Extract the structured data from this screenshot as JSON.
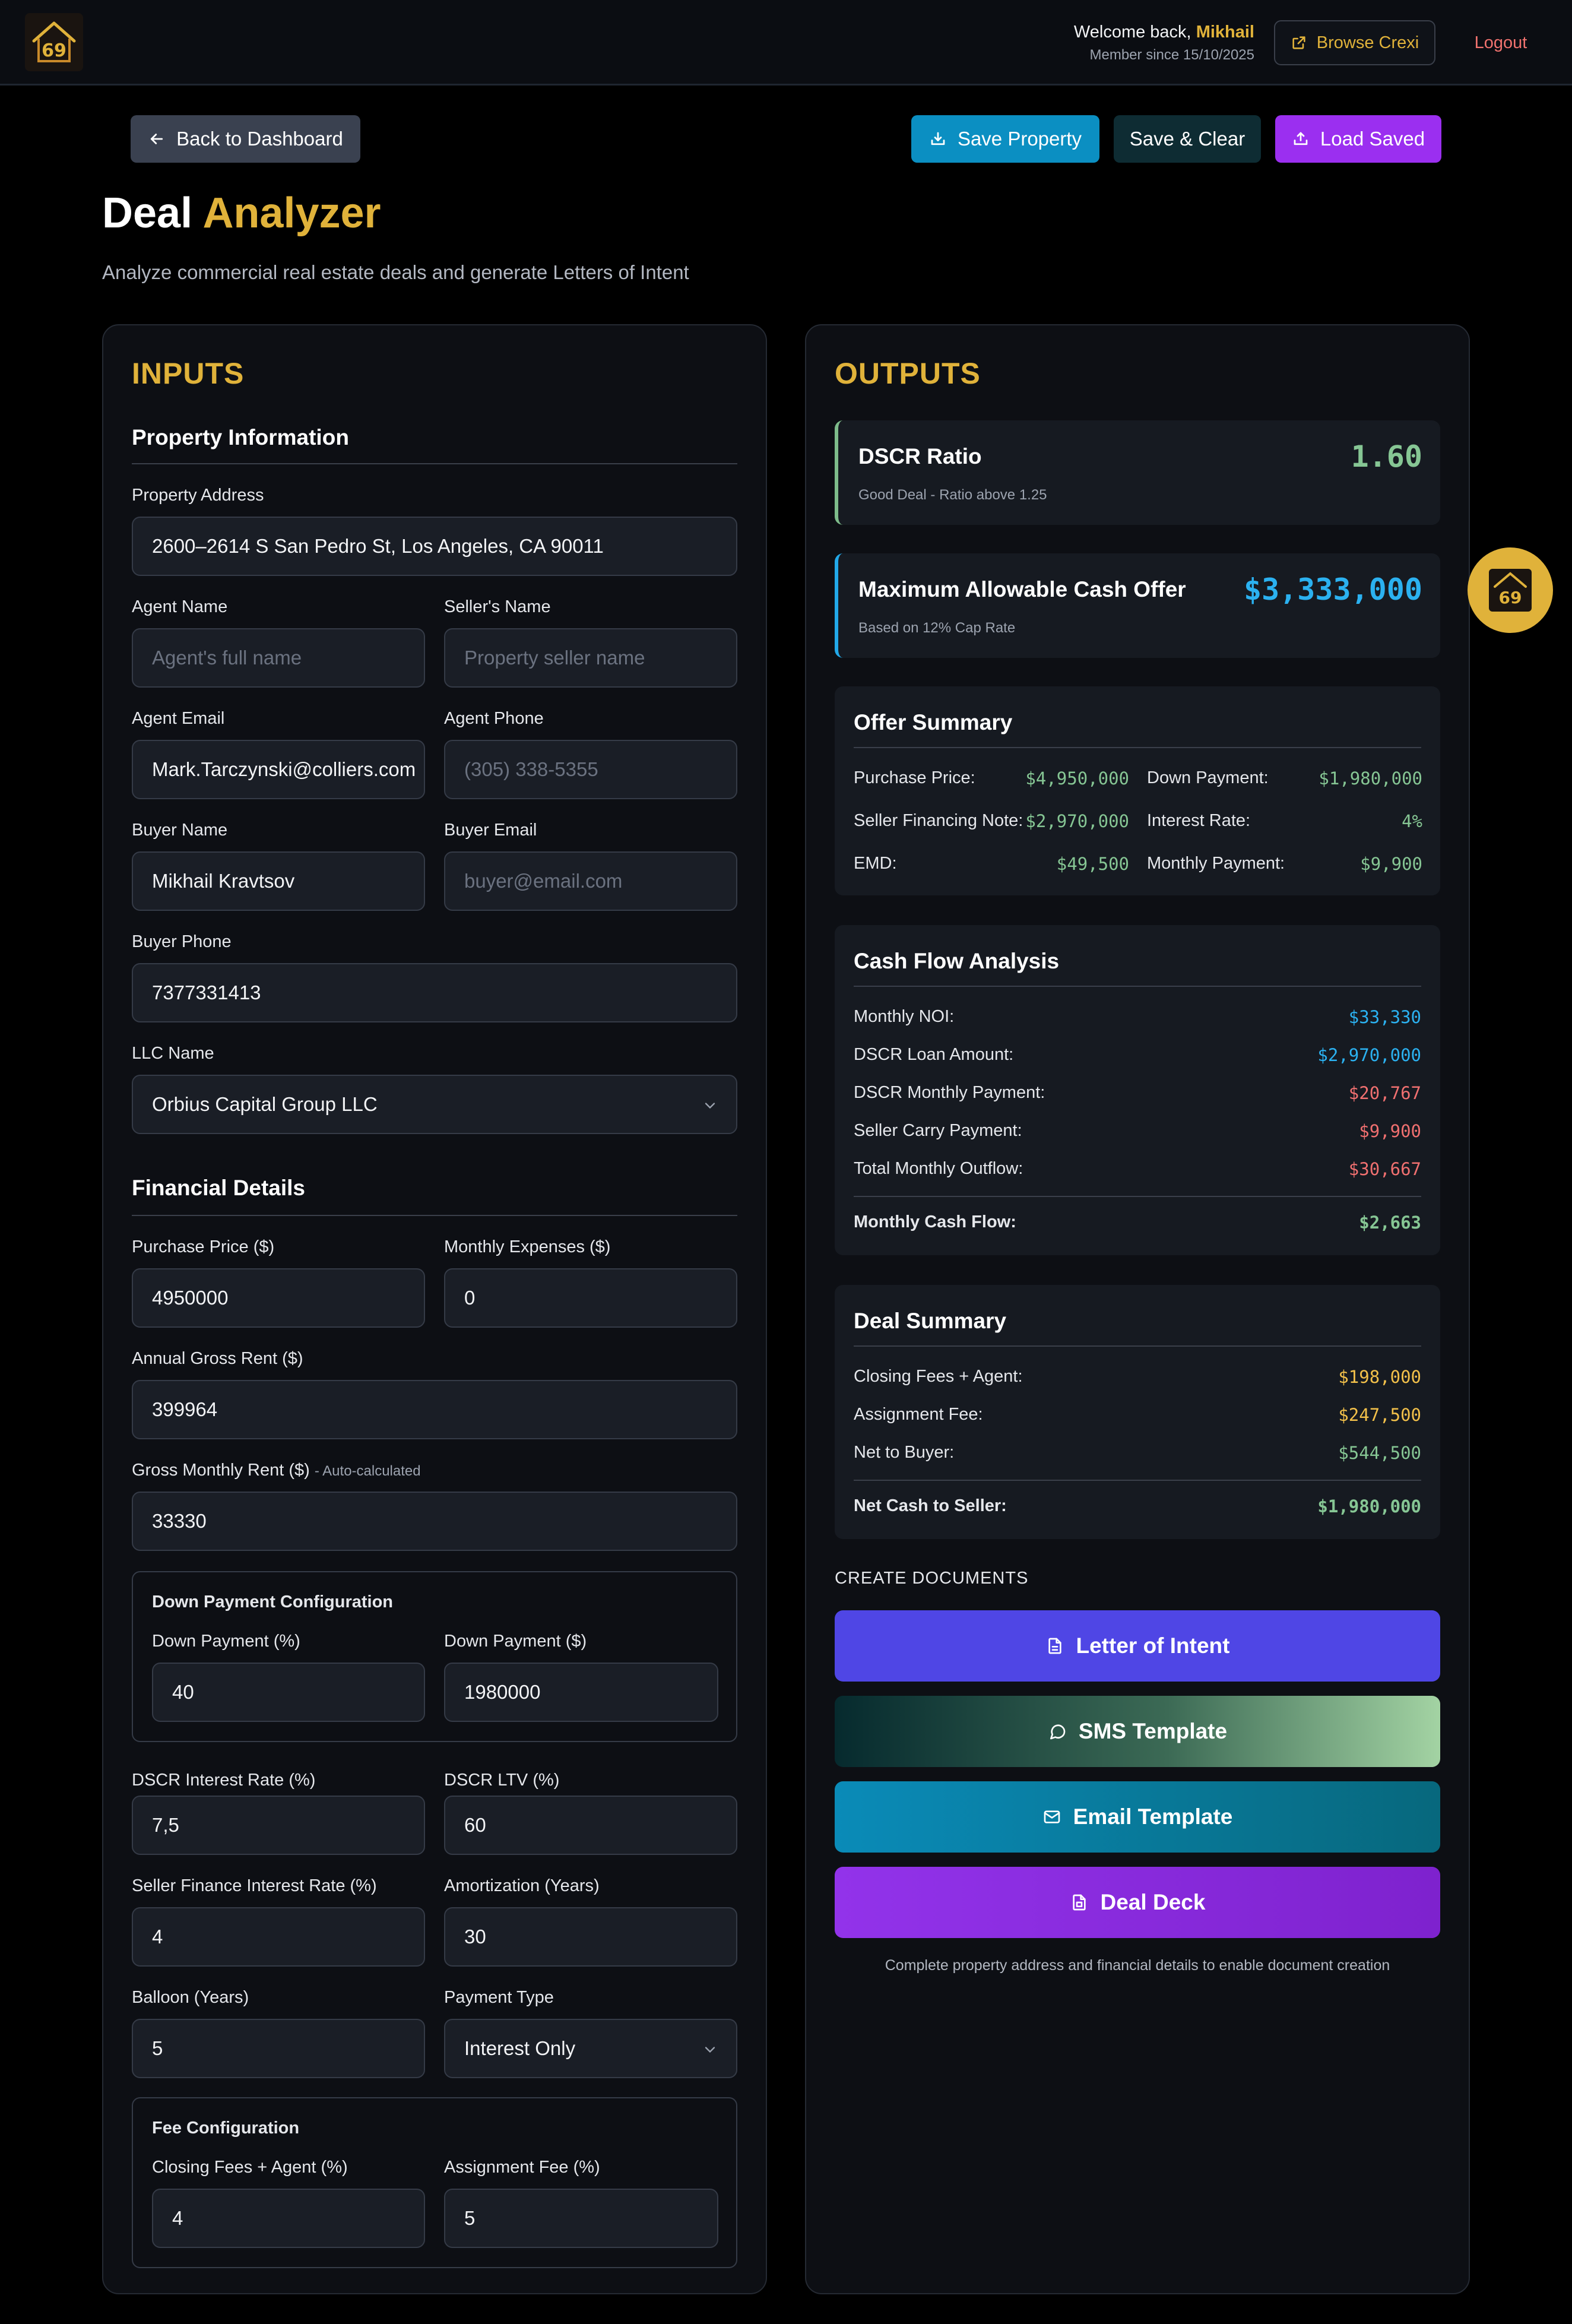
{
  "header": {
    "welcome_prefix": "Welcome back,",
    "user_name": "Mikhail",
    "member_since": "Member since 15/10/2025",
    "browse_label": "Browse Crexi",
    "logout_label": "Logout"
  },
  "actions": {
    "back_label": "Back to Dashboard",
    "save_label": "Save Property",
    "save_clear_label": "Save & Clear",
    "load_label": "Load Saved"
  },
  "page": {
    "title_main": "Deal",
    "title_accent": "Analyzer",
    "subtitle": "Analyze commercial real estate deals and generate Letters of Intent"
  },
  "inputs": {
    "heading": "INPUTS",
    "property_section": "Property Information",
    "property_address": {
      "label": "Property Address",
      "value": "2600–2614 S San Pedro St, Los Angeles, CA 90011"
    },
    "agent_name": {
      "label": "Agent Name",
      "placeholder": "Agent's full name"
    },
    "seller_name": {
      "label": "Seller's Name",
      "placeholder": "Property seller name"
    },
    "agent_email": {
      "label": "Agent Email",
      "value": "Mark.Tarczynski@colliers.com"
    },
    "agent_phone": {
      "label": "Agent Phone",
      "placeholder": "(305) 338-5355"
    },
    "buyer_name": {
      "label": "Buyer Name",
      "value": "Mikhail Kravtsov"
    },
    "buyer_email": {
      "label": "Buyer Email",
      "placeholder": "buyer@email.com"
    },
    "buyer_phone": {
      "label": "Buyer Phone",
      "value": "7377331413"
    },
    "llc_name": {
      "label": "LLC Name",
      "value": "Orbius Capital Group LLC"
    },
    "financial_section": "Financial Details",
    "purchase_price": {
      "label": "Purchase Price ($)",
      "value": "4950000"
    },
    "monthly_expenses": {
      "label": "Monthly Expenses ($)",
      "value": "0"
    },
    "annual_gross_rent": {
      "label": "Annual Gross Rent ($)",
      "value": "399964"
    },
    "gross_monthly_rent": {
      "label": "Gross Monthly Rent ($)",
      "hint": "- Auto-calculated",
      "value": "33330"
    },
    "down_payment_config": {
      "title": "Down Payment Configuration",
      "pct_label": "Down Payment (%)",
      "pct_value": "40",
      "amt_label": "Down Payment ($)",
      "amt_value": "1980000"
    },
    "dscr_rate": {
      "label": "DSCR Interest Rate (%)",
      "value": "7,5"
    },
    "dscr_ltv": {
      "label": "DSCR LTV (%)",
      "value": "60"
    },
    "seller_rate": {
      "label": "Seller Finance Interest Rate (%)",
      "value": "4"
    },
    "amortization": {
      "label": "Amortization (Years)",
      "value": "30"
    },
    "balloon": {
      "label": "Balloon (Years)",
      "value": "5"
    },
    "payment_type": {
      "label": "Payment Type",
      "value": "Interest Only"
    },
    "fee_config": {
      "title": "Fee Configuration",
      "closing_label": "Closing Fees + Agent (%)",
      "closing_value": "4",
      "assignment_label": "Assignment Fee (%)",
      "assignment_value": "5"
    }
  },
  "outputs": {
    "heading": "OUTPUTS",
    "dscr": {
      "title": "DSCR Ratio",
      "value": "1.60",
      "note": "Good Deal - Ratio above 1.25"
    },
    "max_offer": {
      "title": "Maximum Allowable Cash Offer",
      "value": "$3,333,000",
      "note": "Based on 12% Cap Rate"
    },
    "offer_summary": {
      "title": "Offer Summary",
      "purchase_price": {
        "label": "Purchase Price:",
        "value": "$4,950,000"
      },
      "down_payment": {
        "label": "Down Payment:",
        "value": "$1,980,000"
      },
      "seller_note": {
        "label": "Seller Financing Note:",
        "value": "$2,970,000"
      },
      "interest_rate": {
        "label": "Interest Rate:",
        "value": "4%"
      },
      "emd": {
        "label": "EMD:",
        "value": "$49,500"
      },
      "monthly_payment": {
        "label": "Monthly Payment:",
        "value": "$9,900"
      }
    },
    "cash_flow": {
      "title": "Cash Flow Analysis",
      "noi": {
        "label": "Monthly NOI:",
        "value": "$33,330"
      },
      "loan_amount": {
        "label": "DSCR Loan Amount:",
        "value": "$2,970,000"
      },
      "dscr_payment": {
        "label": "DSCR Monthly Payment:",
        "value": "$20,767"
      },
      "seller_payment": {
        "label": "Seller Carry Payment:",
        "value": "$9,900"
      },
      "outflow": {
        "label": "Total Monthly Outflow:",
        "value": "$30,667"
      },
      "cash_flow": {
        "label": "Monthly Cash Flow:",
        "value": "$2,663"
      }
    },
    "deal_summary": {
      "title": "Deal Summary",
      "closing": {
        "label": "Closing Fees + Agent:",
        "value": "$198,000"
      },
      "assignment": {
        "label": "Assignment Fee:",
        "value": "$247,500"
      },
      "net_buyer": {
        "label": "Net to Buyer:",
        "value": "$544,500"
      },
      "net_seller": {
        "label": "Net Cash to Seller:",
        "value": "$1,980,000"
      }
    },
    "documents": {
      "label": "CREATE DOCUMENTS",
      "loi": "Letter of Intent",
      "sms": "SMS Template",
      "email": "Email Template",
      "deck": "Deal Deck",
      "note": "Complete property address and financial details to enable document creation"
    }
  },
  "colors": {
    "accent": "#e0b23a",
    "positive": "#86c694",
    "info": "#2bb1f0",
    "negative": "#f07070",
    "fee": "#f2c04a"
  },
  "icons": [
    "house-logo-icon",
    "external-link-icon",
    "arrow-left-icon",
    "download-icon",
    "upload-icon",
    "chevron-down-icon",
    "document-icon",
    "chat-icon",
    "mail-icon",
    "deck-icon",
    "assistant-icon"
  ]
}
